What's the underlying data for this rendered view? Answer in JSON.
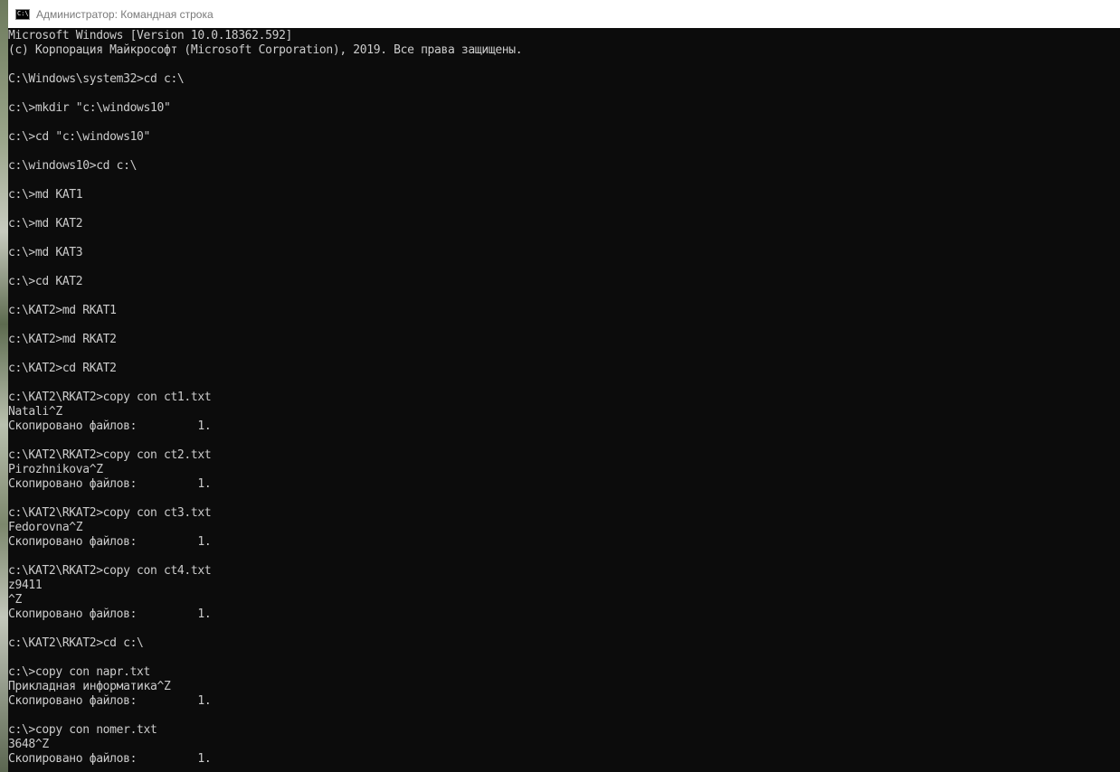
{
  "window": {
    "title": "Администратор: Командная строка",
    "icon": "cmd-icon"
  },
  "console": {
    "lines": [
      "Microsoft Windows [Version 10.0.18362.592]",
      "(c) Корпорация Майкрософт (Microsoft Corporation), 2019. Все права защищены.",
      "",
      "C:\\Windows\\system32>cd c:\\",
      "",
      "c:\\>mkdir \"c:\\windows10\"",
      "",
      "c:\\>cd \"c:\\windows10\"",
      "",
      "c:\\windows10>cd c:\\",
      "",
      "c:\\>md KAT1",
      "",
      "c:\\>md KAT2",
      "",
      "c:\\>md KAT3",
      "",
      "c:\\>cd KAT2",
      "",
      "c:\\KAT2>md RKAT1",
      "",
      "c:\\KAT2>md RKAT2",
      "",
      "c:\\KAT2>cd RKAT2",
      "",
      "c:\\KAT2\\RKAT2>copy con ct1.txt",
      "Natali^Z",
      "Скопировано файлов:         1.",
      "",
      "c:\\KAT2\\RKAT2>copy con ct2.txt",
      "Pirozhnikova^Z",
      "Скопировано файлов:         1.",
      "",
      "c:\\KAT2\\RKAT2>copy con ct3.txt",
      "Fedorovna^Z",
      "Скопировано файлов:         1.",
      "",
      "c:\\KAT2\\RKAT2>copy con ct4.txt",
      "z9411",
      "^Z",
      "Скопировано файлов:         1.",
      "",
      "c:\\KAT2\\RKAT2>cd c:\\",
      "",
      "c:\\>copy con napr.txt",
      "Прикладная информатика^Z",
      "Скопировано файлов:         1.",
      "",
      "c:\\>copy con nomer.txt",
      "3648^Z",
      "Скопировано файлов:         1."
    ]
  }
}
